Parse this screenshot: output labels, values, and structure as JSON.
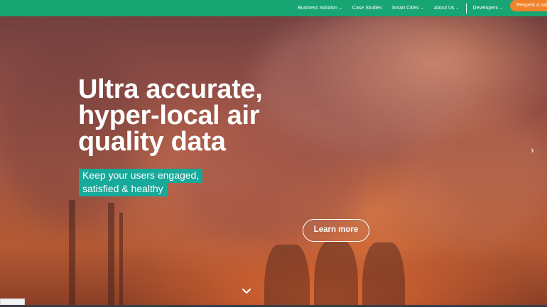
{
  "nav": {
    "items": [
      {
        "label": "Business Solution",
        "has_dropdown": true
      },
      {
        "label": "Case Studies",
        "has_dropdown": false
      },
      {
        "label": "Smart Cities",
        "has_dropdown": true
      },
      {
        "label": "About Us",
        "has_dropdown": true
      },
      {
        "label": "Developers",
        "has_dropdown": true
      }
    ],
    "cta_label": "Request a call",
    "dropdown_glyph": "⌄"
  },
  "hero": {
    "headline": [
      "Ultra accurate,",
      "hyper-local air",
      "quality data"
    ],
    "tagline": [
      "Keep your users engaged,",
      "satisfied & healthy"
    ],
    "button_label": "Learn more",
    "next_glyph": "›"
  },
  "colors": {
    "nav_bg": "#17a573",
    "cta_bg": "#f0822a",
    "tagline_bg": "#17a99a"
  },
  "icons": {
    "next": "chevron-right-icon",
    "scroll": "chevron-down-icon"
  }
}
